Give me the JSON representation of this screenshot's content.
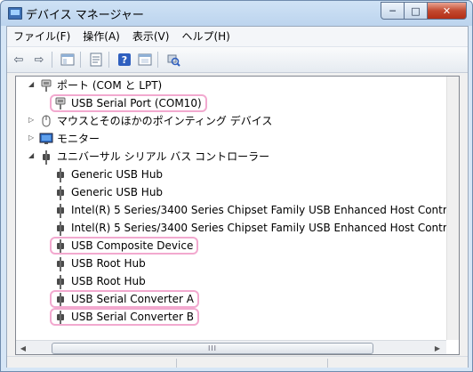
{
  "window": {
    "title": "デバイス マネージャー",
    "min_label": "─",
    "max_label": "□",
    "close_label": "✕"
  },
  "menu": [
    "ファイル(F)",
    "操作(A)",
    "表示(V)",
    "ヘルプ(H)"
  ],
  "toolbar": {
    "back": "⇦",
    "forward": "⇨",
    "help": "?"
  },
  "tree": [
    {
      "label": "ポート (COM と LPT)",
      "level": 1,
      "expand": "◢",
      "icon": "port-icon"
    },
    {
      "label": "USB Serial Port (COM10)",
      "level": 2,
      "icon": "port-icon",
      "highlight": true
    },
    {
      "label": "マウスとそのほかのポインティング デバイス",
      "level": 1,
      "expand": "▷",
      "icon": "mouse-icon"
    },
    {
      "label": "モニター",
      "level": 1,
      "expand": "▷",
      "icon": "monitor-icon"
    },
    {
      "label": "ユニバーサル シリアル バス コントローラー",
      "level": 1,
      "expand": "◢",
      "icon": "usb-icon"
    },
    {
      "label": "Generic USB Hub",
      "level": 2,
      "icon": "usb-icon"
    },
    {
      "label": "Generic USB Hub",
      "level": 2,
      "icon": "usb-icon"
    },
    {
      "label": "Intel(R) 5 Series/3400 Series Chipset Family USB Enhanced Host Contr",
      "level": 2,
      "icon": "usb-icon"
    },
    {
      "label": "Intel(R) 5 Series/3400 Series Chipset Family USB Enhanced Host Contr",
      "level": 2,
      "icon": "usb-icon"
    },
    {
      "label": "USB Composite Device",
      "level": 2,
      "icon": "usb-icon",
      "highlight": true
    },
    {
      "label": "USB Root Hub",
      "level": 2,
      "icon": "usb-icon"
    },
    {
      "label": "USB Root Hub",
      "level": 2,
      "icon": "usb-icon"
    },
    {
      "label": "USB Serial Converter A",
      "level": 2,
      "icon": "usb-icon",
      "highlight": true
    },
    {
      "label": "USB Serial Converter B",
      "level": 2,
      "icon": "usb-icon",
      "highlight": true
    }
  ],
  "scroll": {
    "left_arrow": "◀",
    "right_arrow": "▶",
    "thumb_grip": "III"
  },
  "highlight_color": "#f2a9cf"
}
